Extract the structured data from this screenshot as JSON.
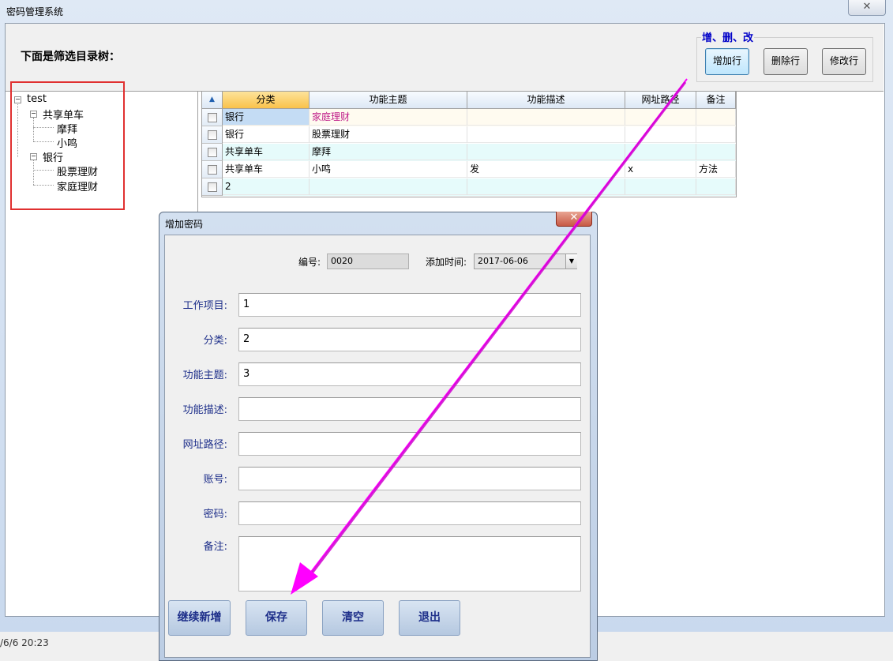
{
  "window": {
    "title": "密码管理系统",
    "close_glyph": "✕"
  },
  "top": {
    "tree_heading": "下面是筛选目录树：",
    "group_title": "增、删、改",
    "add_row": "增加行",
    "delete_row": "删除行",
    "edit_row": "修改行"
  },
  "tree": {
    "root": "test",
    "nodes": [
      {
        "label": "共享单车",
        "children": [
          "摩拜",
          "小鸣"
        ]
      },
      {
        "label": "银行",
        "children": [
          "股票理财",
          "家庭理财"
        ]
      }
    ]
  },
  "grid": {
    "lock_glyph": "🔒",
    "columns": [
      "分类",
      "功能主题",
      "功能描述",
      "网址路径",
      "备注"
    ],
    "rows": [
      [
        "银行",
        "家庭理财",
        "",
        "",
        ""
      ],
      [
        "银行",
        "股票理财",
        "",
        "",
        ""
      ],
      [
        "共享单车",
        "摩拜",
        "",
        "",
        ""
      ],
      [
        "共享单车",
        "小鸣",
        "发",
        "x",
        "方法"
      ],
      [
        "2",
        "",
        "",
        "",
        ""
      ]
    ]
  },
  "dialog": {
    "title": "增加密码",
    "close_glyph": "✕",
    "id_label": "编号:",
    "id_value": "0020",
    "time_label": "添加时间:",
    "time_value": "2017-06-06",
    "fields": [
      {
        "label": "工作项目:",
        "value": "1"
      },
      {
        "label": "分类:",
        "value": "2"
      },
      {
        "label": "功能主题:",
        "value": "3"
      },
      {
        "label": "功能描述:",
        "value": ""
      },
      {
        "label": "网址路径:",
        "value": ""
      },
      {
        "label": "账号:",
        "value": ""
      },
      {
        "label": "密码:",
        "value": ""
      },
      {
        "label": "备注:",
        "value": ""
      }
    ],
    "buttons": {
      "continue": "继续新增",
      "save": "保存",
      "clear": "清空",
      "exit": "退出"
    }
  },
  "status": {
    "time": "/6/6 20:23"
  },
  "colors": {
    "annotation_arrow": "#ff00ff",
    "highlight_box": "#e03030",
    "selected_cell_text": "#c0208a"
  }
}
